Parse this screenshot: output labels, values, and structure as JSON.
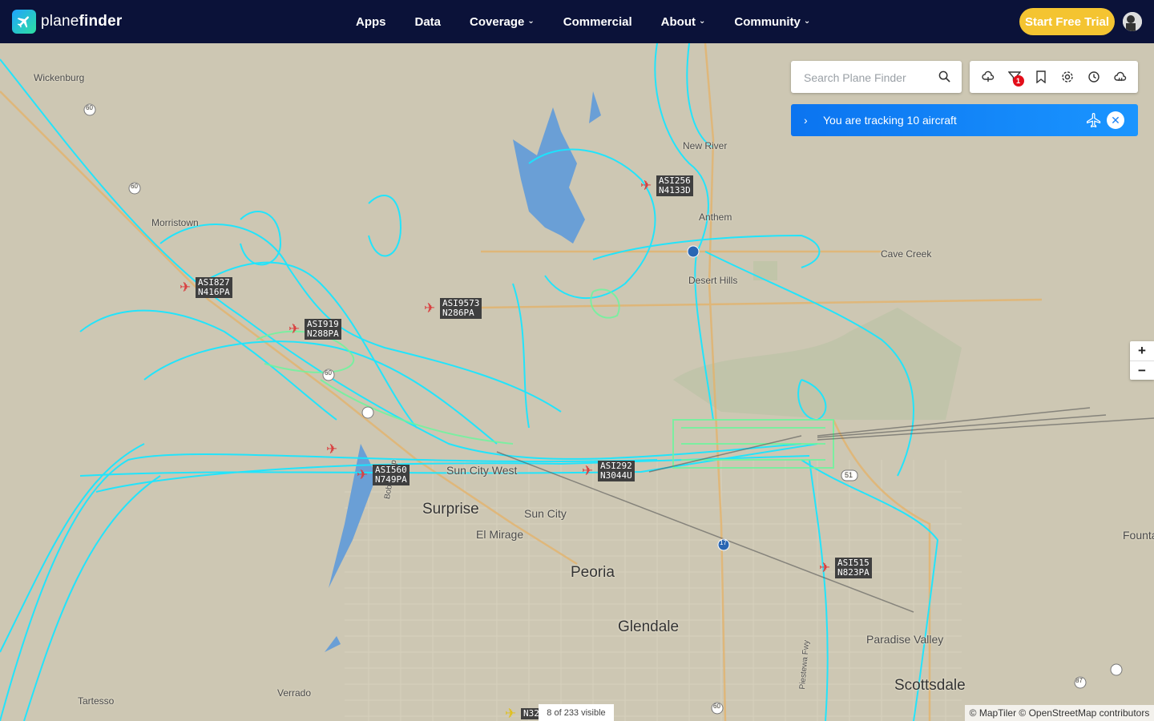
{
  "brand": {
    "name_plain": "plane",
    "name_bold": "finder"
  },
  "nav": [
    {
      "label": "Apps",
      "dropdown": false
    },
    {
      "label": "Data",
      "dropdown": false
    },
    {
      "label": "Coverage",
      "dropdown": true
    },
    {
      "label": "Commercial",
      "dropdown": false
    },
    {
      "label": "About",
      "dropdown": true
    },
    {
      "label": "Community",
      "dropdown": true
    }
  ],
  "cta": {
    "label": "Start Free Trial"
  },
  "search": {
    "placeholder": "Search Plane Finder"
  },
  "tools": {
    "filter_badge": "1",
    "icons": [
      "cloud-icon",
      "filter-icon",
      "bookmark-icon",
      "settings-icon",
      "history-icon",
      "weather-icon"
    ]
  },
  "tracking": {
    "text": "You are tracking 10 aircraft"
  },
  "zoom": {
    "in": "+",
    "out": "−"
  },
  "places": {
    "wickenburg": "Wickenburg",
    "morristown": "Morristown",
    "new_river": "New River",
    "anthem": "Anthem",
    "cave_creek": "Cave Creek",
    "desert_hills": "Desert Hills",
    "surprise": "Surprise",
    "sun_city": "Sun City",
    "sun_city_west": "Sun City West",
    "el_mirage": "El Mirage",
    "peoria": "Peoria",
    "glendale": "Glendale",
    "paradise_valley": "Paradise Valley",
    "scottsdale": "Scottsdale",
    "verrado": "Verrado",
    "tartesso": "Tartesso",
    "fountain": "Founta",
    "bob_stump": "Bob Stump",
    "piestewa": "Piestewa Fwy"
  },
  "highways": {
    "h60a": "60",
    "h60b": "60",
    "h60c": "60",
    "h60d": "60",
    "h51": "51",
    "h17": "17",
    "h87": "87"
  },
  "aircraft": [
    {
      "callsign": "ASI256",
      "reg": "N4133D"
    },
    {
      "callsign": "ASI827",
      "reg": "N416PA"
    },
    {
      "callsign": "ASI9573",
      "reg": "N286PA"
    },
    {
      "callsign": "ASI919",
      "reg": "N288PA"
    },
    {
      "callsign": "ASI560",
      "reg": "N749PA"
    },
    {
      "callsign": "ASI292",
      "reg": "N3044U"
    },
    {
      "callsign": "ASI515",
      "reg": "N823PA"
    },
    {
      "callsign": "N32",
      "reg": ""
    }
  ],
  "visible": "8 of 233 visible",
  "attribution": "© MapTiler © OpenStreetMap contributors",
  "colors": {
    "nav_bg": "#0b1239",
    "cta": "#f4c431",
    "track_primary": "#19e6ff",
    "track_secondary": "#6df59d",
    "tracking_bar": "#1a82f5",
    "plane": "#d94040"
  }
}
